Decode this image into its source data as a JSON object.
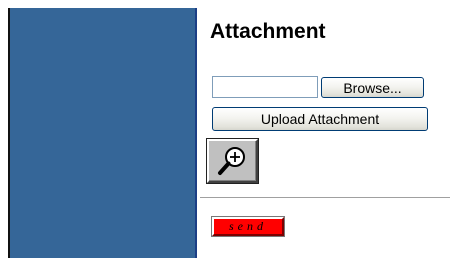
{
  "attachment": {
    "title": "Attachment",
    "file_value": "",
    "browse_label": "Browse...",
    "upload_label": "Upload Attachment",
    "zoom_icon": "zoom-in-magnifier-icon",
    "send_label": "send"
  },
  "colors": {
    "left_panel": "#356698",
    "panel_border": "#1c3f86",
    "send_background": "#ff0000",
    "button_border": "#003c74"
  }
}
